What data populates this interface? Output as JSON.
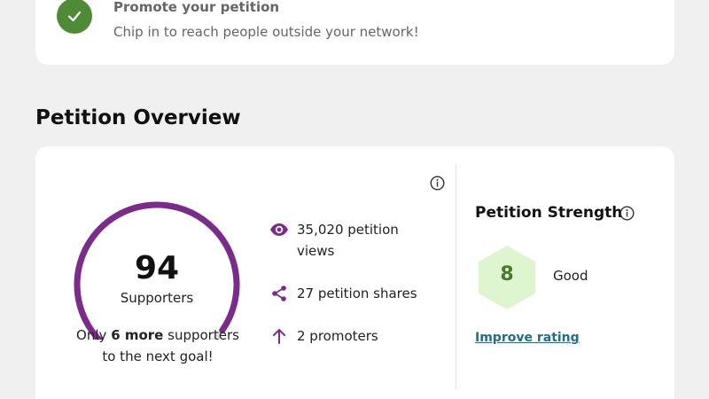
{
  "promo": {
    "title": "Promote your petition",
    "subtitle": "Chip in to reach people outside your network!",
    "icon": "check-icon",
    "accent": "#4f8a36"
  },
  "overview": {
    "title": "Petition Overview",
    "supporters": {
      "count": "94",
      "label": "Supporters",
      "goal_prefix": "Only ",
      "goal_bold": "6 more",
      "goal_suffix": " supporters to the next goal!",
      "progress_fraction": 0.94,
      "accent": "#7b2c8a"
    },
    "stats": [
      {
        "icon": "eye-icon",
        "text": "35,020 petition views"
      },
      {
        "icon": "share-icon",
        "text": "27 petition shares"
      },
      {
        "icon": "arrow-up-icon",
        "text": "2 promoters"
      }
    ]
  },
  "strength": {
    "title": "Petition Strength",
    "score": "8",
    "label": "Good",
    "improve_link": "Improve rating",
    "hex_color": "#dff5cf",
    "link_color": "#1f6f8b"
  }
}
